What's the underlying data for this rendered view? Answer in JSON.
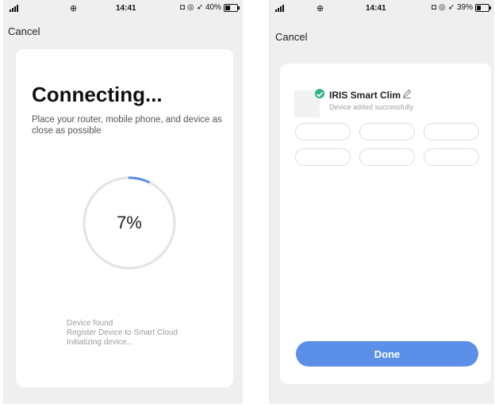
{
  "left": {
    "status": {
      "time": "14:41",
      "battery": "40%",
      "battery_level": 0.4
    },
    "cancel_label": "Cancel",
    "title": "Connecting...",
    "description": "Place your router, mobile phone, and device as close as possible",
    "progress": {
      "label": "7%",
      "value": 0.07
    },
    "steps": [
      "Device found",
      "Register Device to Smart Cloud",
      "Initializing device..."
    ]
  },
  "right": {
    "status": {
      "time": "14:41",
      "battery": "39%",
      "battery_level": 0.39
    },
    "cancel_label": "Cancel",
    "device": {
      "name": "IRIS Smart Clim",
      "status": "Device added successfully"
    },
    "done_label": "Done"
  },
  "colors": {
    "accent": "#5b8fe8",
    "success": "#2fb47f",
    "ring_track": "#e3e3e3"
  }
}
